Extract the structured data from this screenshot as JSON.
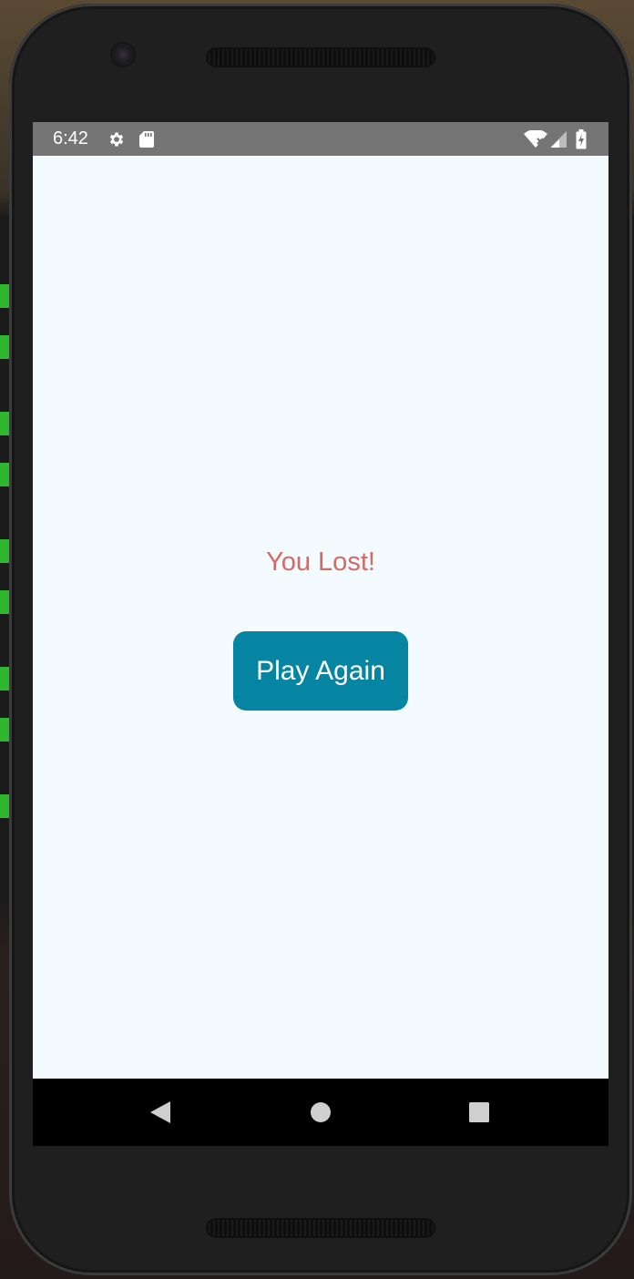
{
  "status_bar": {
    "time": "6:42",
    "icons": [
      "settings-icon",
      "sd-card-icon",
      "wifi-no-internet-icon",
      "cell-signal-icon",
      "battery-charging-icon"
    ]
  },
  "game": {
    "result_text": "You Lost!",
    "play_again_label": "Play Again"
  },
  "navigation": {
    "buttons": [
      "back-icon",
      "home-icon",
      "recents-icon"
    ]
  },
  "colors": {
    "result_text": "#d46a66",
    "button_background": "#0585a1",
    "screen_background": "#f3fbfe",
    "status_bar": "#757575",
    "nav_bar": "#000000"
  }
}
